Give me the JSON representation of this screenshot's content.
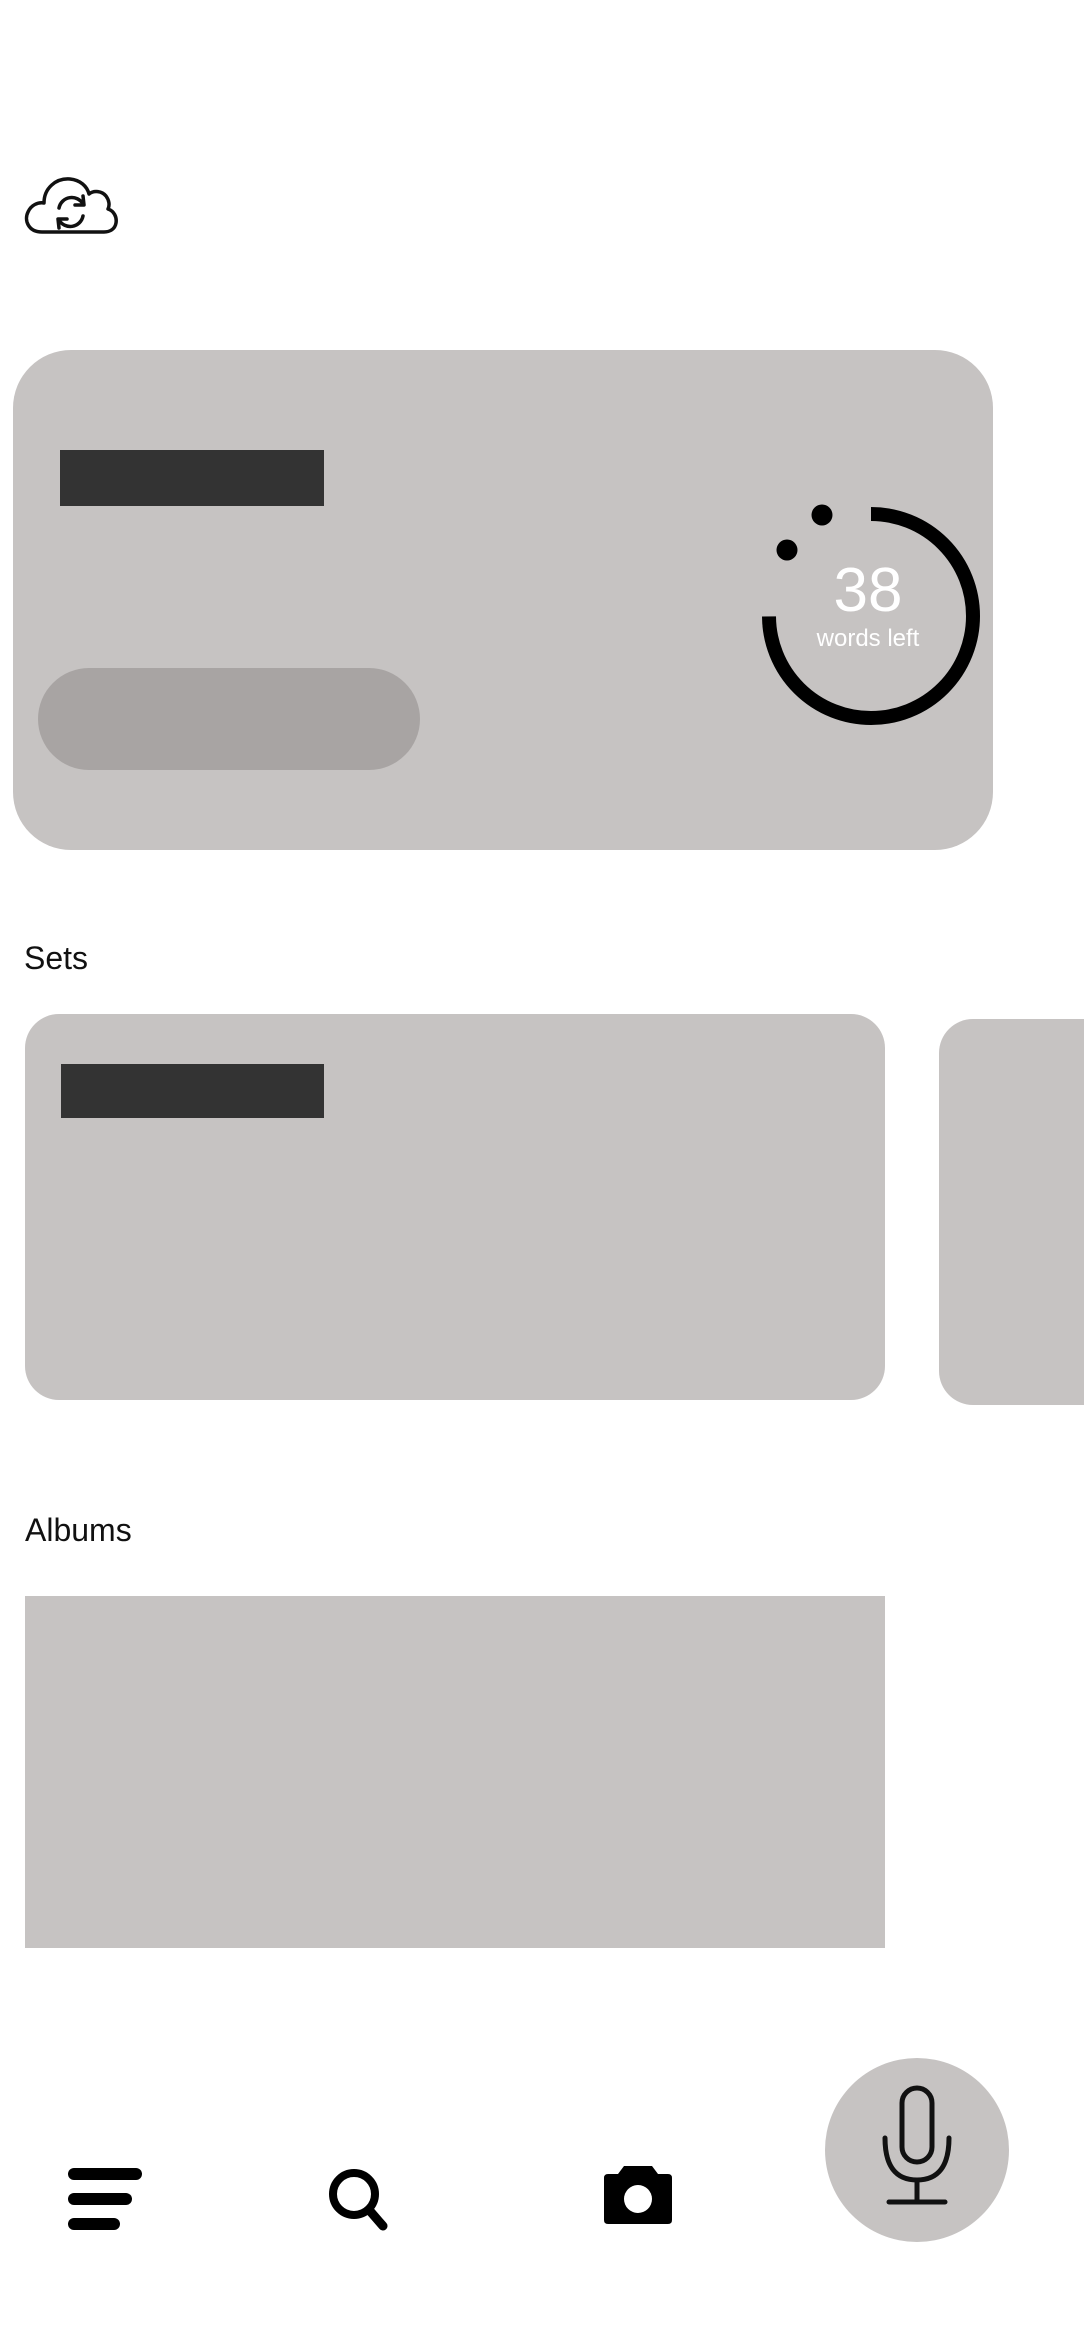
{
  "header": {
    "sync_icon": "cloud-sync-icon"
  },
  "hero": {
    "progress": {
      "value": "38",
      "label": "words left"
    }
  },
  "sections": {
    "sets_heading": "Sets",
    "albums_heading": "Albums"
  },
  "bottom_nav": {
    "items": [
      {
        "icon": "menu-icon"
      },
      {
        "icon": "search-icon"
      },
      {
        "icon": "camera-icon"
      },
      {
        "icon": "microphone-icon"
      }
    ]
  },
  "colors": {
    "card_bg": "#c6c3c2",
    "placeholder_dark": "#333333",
    "pill_bg": "#a8a4a3",
    "ring": "#000000",
    "progress_text": "#ffffff"
  }
}
